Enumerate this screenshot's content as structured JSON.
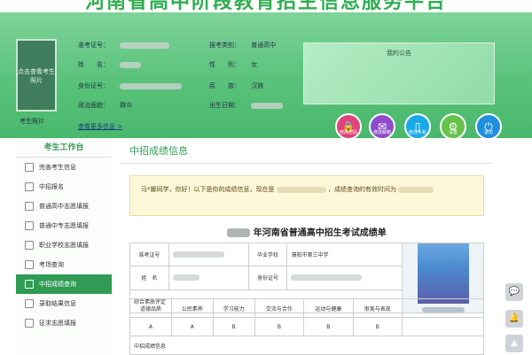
{
  "banner": {
    "title": "河南省高中阶段教育招生信息服务平台"
  },
  "header": {
    "photo_placeholder": "点击查看考生照片",
    "photo_caption": "考生照片",
    "fields": {
      "exam_no_label": "准考证号：",
      "name_label": "姓　　名：",
      "id_label": "身份证号：",
      "politics_label": "政治面貌：",
      "politics_value": "群众",
      "category_label": "报考类别：",
      "category_value": "普通高中",
      "gender_label": "性　　别：",
      "gender_value": "女",
      "ethnic_label": "民　　族：",
      "ethnic_value": "汉族",
      "birthday_label": "出生日期："
    },
    "more_link": "查看更多信息 >",
    "notice_title": "我的公告"
  },
  "actions": [
    {
      "label": "修改密码",
      "icon": "lock-icon",
      "color": "#e0427a",
      "glyph": "🔒"
    },
    {
      "label": "修改邮箱",
      "icon": "mail-icon",
      "color": "#8e4cc9",
      "glyph": "✉"
    },
    {
      "label": "修改手机",
      "icon": "phone-icon",
      "color": "#19a9e6",
      "glyph": "▯"
    },
    {
      "label": "设置",
      "icon": "gear-icon",
      "color": "#66c24a",
      "glyph": "⚙"
    },
    {
      "label": "退出",
      "icon": "power-icon",
      "color": "#1f8fe0",
      "glyph": "⏻"
    }
  ],
  "sidebar": {
    "title": "考生工作台",
    "items": [
      {
        "label": "完善考生信息"
      },
      {
        "label": "中招报名"
      },
      {
        "label": "普通高中志愿填报"
      },
      {
        "label": "普通中专志愿填报"
      },
      {
        "label": "职业学校志愿填报"
      },
      {
        "label": "考场查询"
      },
      {
        "label": "中招成绩查询"
      },
      {
        "label": "录取结果信息"
      },
      {
        "label": "征求志愿填报"
      }
    ],
    "active_index": 6
  },
  "main": {
    "title": "中招成绩信息",
    "notice_prefix": "马*娜同学，你好！以下是你的成绩信息，现在是",
    "notice_suffix": "，成绩查询的有效时间为",
    "report_title": "年河南省普通高中招生考试成绩单",
    "table": {
      "exam_no_label": "准考证号",
      "name_label": "姓　名",
      "school_label": "毕业学校",
      "school_value": "濮阳市第三中学",
      "id_label": "身份证号",
      "quality_header": "综合素质评定",
      "quality_cols": [
        "道德品质",
        "公民素养",
        "学习能力",
        "交流与合作",
        "运动与健康",
        "审美与表现"
      ],
      "quality_vals": [
        "A",
        "A",
        "B",
        "B",
        "B",
        "B"
      ],
      "score_header": "中招成绩信息"
    }
  },
  "float_buttons": [
    {
      "icon": "chat-icon",
      "glyph": "💬"
    },
    {
      "icon": "bell-icon",
      "glyph": "🔔"
    },
    {
      "icon": "arrow-up-icon",
      "glyph": "▲"
    }
  ]
}
